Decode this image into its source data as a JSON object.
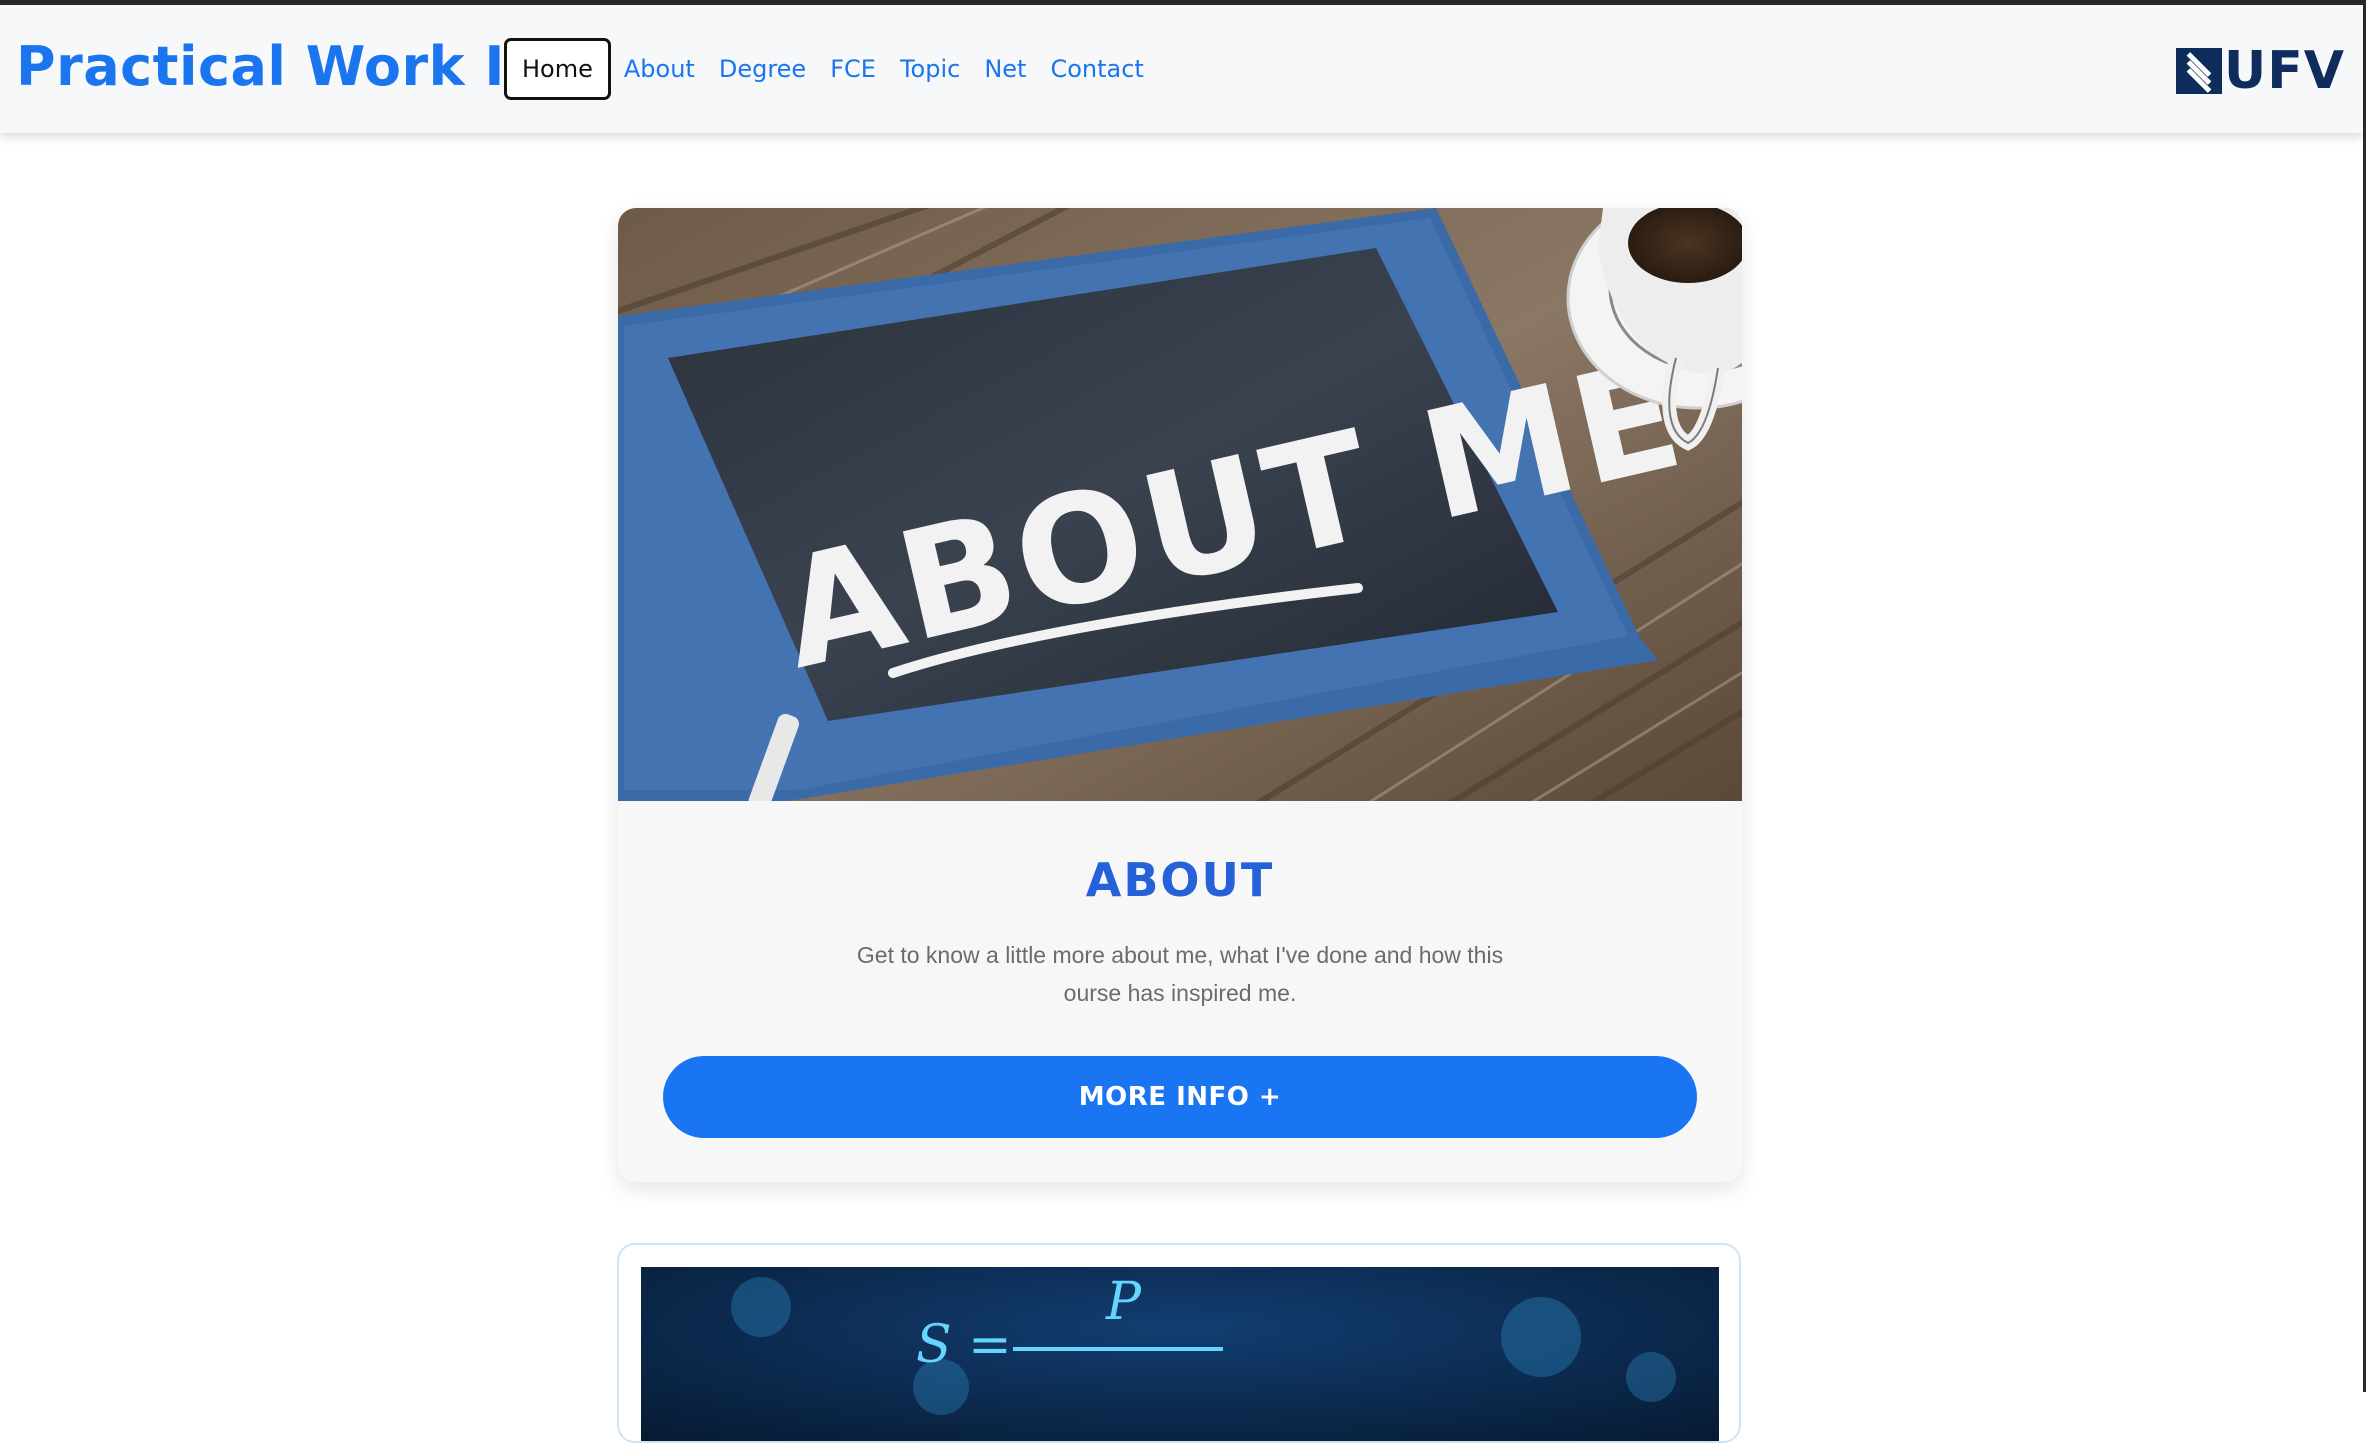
{
  "navbar": {
    "brand": "Practical Work II",
    "links": [
      "Home",
      "About",
      "Degree",
      "FCE",
      "Topic",
      "Net",
      "Contact"
    ],
    "logo_text": "UFV"
  },
  "about_card": {
    "image_text": "ABOUT ME",
    "title": "ABOUT",
    "description_line1": "Get to know a little more about me, what I've done and how this",
    "description_line2": "ourse has inspired me.",
    "button_label": "MORE INFO +"
  },
  "second_card": {
    "formula_left": "S =",
    "formula_numerator": "P"
  },
  "colors": {
    "brand": "#1a75ee",
    "button": "#1a75f2",
    "title": "#2561d8",
    "logo": "#0e2d5c"
  }
}
